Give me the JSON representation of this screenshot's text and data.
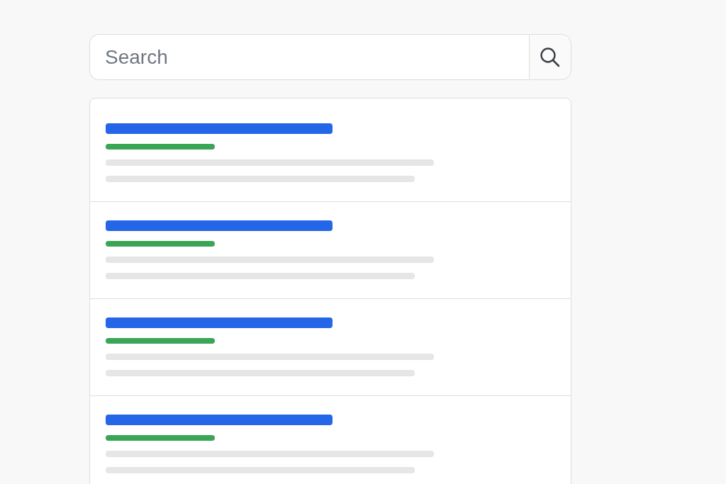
{
  "search": {
    "placeholder": "Search"
  },
  "results": [
    {
      "kind": "skeleton"
    },
    {
      "kind": "skeleton"
    },
    {
      "kind": "skeleton"
    },
    {
      "kind": "skeleton"
    }
  ]
}
